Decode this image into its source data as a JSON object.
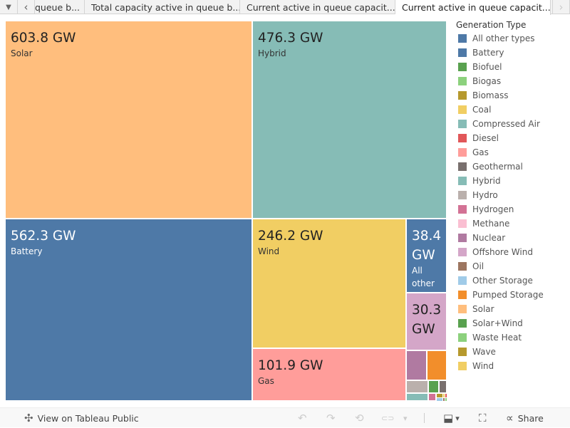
{
  "tabs": {
    "items": [
      {
        "label": "queue b..."
      },
      {
        "label": "Total capacity active in queue b..."
      },
      {
        "label": "Current active in queue capacit..."
      },
      {
        "label": "Current active in queue capacit...",
        "active": true
      }
    ]
  },
  "chart_data": {
    "type": "treemap",
    "title": "",
    "unit": "GW",
    "tiles": [
      {
        "name": "Solar",
        "value": 603.8,
        "display": "603.8 GW",
        "label": "Solar",
        "color": "#FFBE7D"
      },
      {
        "name": "Battery",
        "value": 562.3,
        "display": "562.3 GW",
        "label": "Battery",
        "color": "#4E79A7"
      },
      {
        "name": "Hybrid",
        "value": 476.3,
        "display": "476.3 GW",
        "label": "Hybrid",
        "color": "#86BCB6"
      },
      {
        "name": "Wind",
        "value": 246.2,
        "display": "246.2 GW",
        "label": "Wind",
        "color": "#F1CE63"
      },
      {
        "name": "Gas",
        "value": 101.9,
        "display": "101.9 GW",
        "label": "Gas",
        "color": "#FF9D9A"
      },
      {
        "name": "All other types",
        "value": 38.4,
        "display_line1": "38.4",
        "display_line2": "GW",
        "label_line1": "All",
        "label_line2": "other",
        "color": "#4E79A7"
      },
      {
        "name": "Offshore Wind",
        "value": 30.3,
        "display_line1": "30.3",
        "display_line2": "GW",
        "color": "#D4A6C8"
      },
      {
        "name": "Nuclear",
        "value": 16.0,
        "color": "#B07AA1"
      },
      {
        "name": "Pumped Storage",
        "value": 15.0,
        "color": "#F28E2B"
      },
      {
        "name": "Hydro",
        "value": 8.0,
        "color": "#BAB0AC"
      },
      {
        "name": "Solar+Wind",
        "value": 4.5,
        "color": "#59A14F"
      },
      {
        "name": "Geothermal",
        "value": 3.5,
        "color": "#79706E"
      },
      {
        "name": "Compressed Air",
        "value": 4.5,
        "color": "#86BCB6"
      },
      {
        "name": "Hydrogen",
        "value": 2.0,
        "color": "#D37295"
      },
      {
        "name": "Biomass",
        "value": 1.2,
        "color": "#B6992D"
      },
      {
        "name": "Other Storage",
        "value": 1.0,
        "color": "#A0CBE8"
      },
      {
        "name": "Coal",
        "value": 0.3,
        "color": "#F1CE63"
      },
      {
        "name": "Diesel",
        "value": 0.3,
        "color": "#E15759"
      },
      {
        "name": "Oil",
        "value": 0.2,
        "color": "#9D7660"
      },
      {
        "name": "Waste Heat",
        "value": 0.1,
        "color": "#8CD17D"
      }
    ],
    "legend": {
      "title": "Generation Type",
      "position": "right",
      "items": [
        {
          "label": "All other types",
          "color": "#4E79A7"
        },
        {
          "label": "Battery",
          "color": "#4E79A7"
        },
        {
          "label": "Biofuel",
          "color": "#59A14F"
        },
        {
          "label": "Biogas",
          "color": "#8CD17D"
        },
        {
          "label": "Biomass",
          "color": "#B6992D"
        },
        {
          "label": "Coal",
          "color": "#F1CE63"
        },
        {
          "label": "Compressed Air",
          "color": "#86BCB6"
        },
        {
          "label": "Diesel",
          "color": "#E15759"
        },
        {
          "label": "Gas",
          "color": "#FF9D9A"
        },
        {
          "label": "Geothermal",
          "color": "#79706E"
        },
        {
          "label": "Hybrid",
          "color": "#86BCB6"
        },
        {
          "label": "Hydro",
          "color": "#BAB0AC"
        },
        {
          "label": "Hydrogen",
          "color": "#D37295"
        },
        {
          "label": "Methane",
          "color": "#FABFD2"
        },
        {
          "label": "Nuclear",
          "color": "#B07AA1"
        },
        {
          "label": "Offshore Wind",
          "color": "#D4A6C8"
        },
        {
          "label": "Oil",
          "color": "#9D7660"
        },
        {
          "label": "Other Storage",
          "color": "#A0CBE8"
        },
        {
          "label": "Pumped Storage",
          "color": "#F28E2B"
        },
        {
          "label": "Solar",
          "color": "#FFBE7D"
        },
        {
          "label": "Solar+Wind",
          "color": "#59A14F"
        },
        {
          "label": "Waste Heat",
          "color": "#8CD17D"
        },
        {
          "label": "Wave",
          "color": "#B6992D"
        },
        {
          "label": "Wind",
          "color": "#F1CE63"
        }
      ]
    }
  },
  "footer": {
    "view_label": "View on Tableau Public",
    "share_label": "Share"
  },
  "icons": {
    "tab_menu": "▼",
    "tab_prev": "‹",
    "tab_next": "›",
    "tableau_logo": "✣",
    "undo": "↶",
    "redo": "↷",
    "revert": "⟲",
    "refresh": "⊂⊃",
    "dropdown": "▾",
    "download": "⬓",
    "fullscreen": "⛶",
    "share": "∝"
  }
}
